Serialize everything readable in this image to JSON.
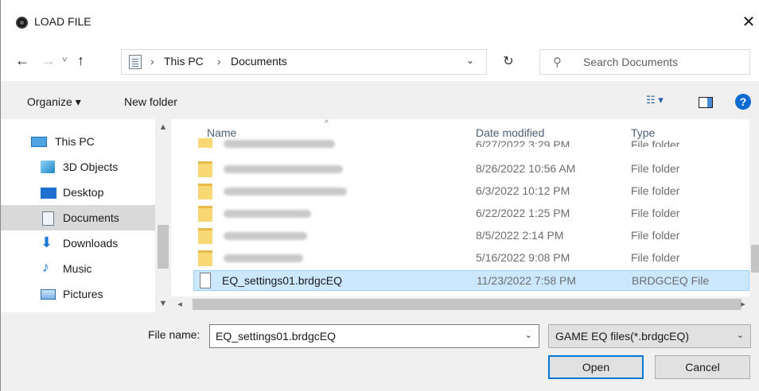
{
  "window": {
    "title": "LOAD FILE",
    "close_glyph": "✕"
  },
  "nav": {
    "back_glyph": "←",
    "forward_glyph": "→",
    "recent_glyph": "˅",
    "up_glyph": "↑",
    "breadcrumb": [
      "This PC",
      "Documents"
    ],
    "breadcrumb_sep": "›",
    "dropdown_glyph": "⌄",
    "refresh_glyph": "↻",
    "search_placeholder": "Search Documents",
    "search_glyph": "⚲"
  },
  "toolbar": {
    "organize_label": "Organize ▾",
    "new_folder_label": "New folder",
    "view_glyph": "☷ ▾",
    "help_glyph": "?"
  },
  "sidebar": {
    "items": [
      {
        "label": "This PC",
        "icon": "monitor-icon"
      },
      {
        "label": "3D Objects",
        "icon": "cube-icon"
      },
      {
        "label": "Desktop",
        "icon": "desktop-icon"
      },
      {
        "label": "Documents",
        "icon": "document-icon",
        "selected": true
      },
      {
        "label": "Downloads",
        "icon": "download-icon"
      },
      {
        "label": "Music",
        "icon": "music-note-icon"
      },
      {
        "label": "Pictures",
        "icon": "pictures-icon"
      }
    ]
  },
  "filelist": {
    "columns": {
      "name": "Name",
      "date": "Date modified",
      "type": "Type"
    },
    "sort_glyph": "^",
    "rows": [
      {
        "name": "",
        "date": "6/27/2022 3:29 PM",
        "type": "File folder",
        "kind": "folder",
        "partial": true
      },
      {
        "name": "",
        "date": "8/26/2022 10:56 AM",
        "type": "File folder",
        "kind": "folder"
      },
      {
        "name": "",
        "date": "6/3/2022 10:12 PM",
        "type": "File folder",
        "kind": "folder"
      },
      {
        "name": "",
        "date": "6/22/2022 1:25 PM",
        "type": "File folder",
        "kind": "folder"
      },
      {
        "name": "",
        "date": "8/5/2022 2:14 PM",
        "type": "File folder",
        "kind": "folder"
      },
      {
        "name": "",
        "date": "5/16/2022 9:08 PM",
        "type": "File folder",
        "kind": "folder"
      },
      {
        "name": "EQ_settings01.brdgcEQ",
        "date": "11/23/2022 7:58 PM",
        "type": "BRDGCEQ File",
        "kind": "file",
        "selected": true
      }
    ]
  },
  "bottom": {
    "filename_label": "File name:",
    "filename_value": "EQ_settings01.brdgcEQ",
    "filetype_value": "GAME EQ files(*.brdgcEQ)",
    "open_label": "Open",
    "cancel_label": "Cancel",
    "dropdown_glyph": "⌄"
  }
}
